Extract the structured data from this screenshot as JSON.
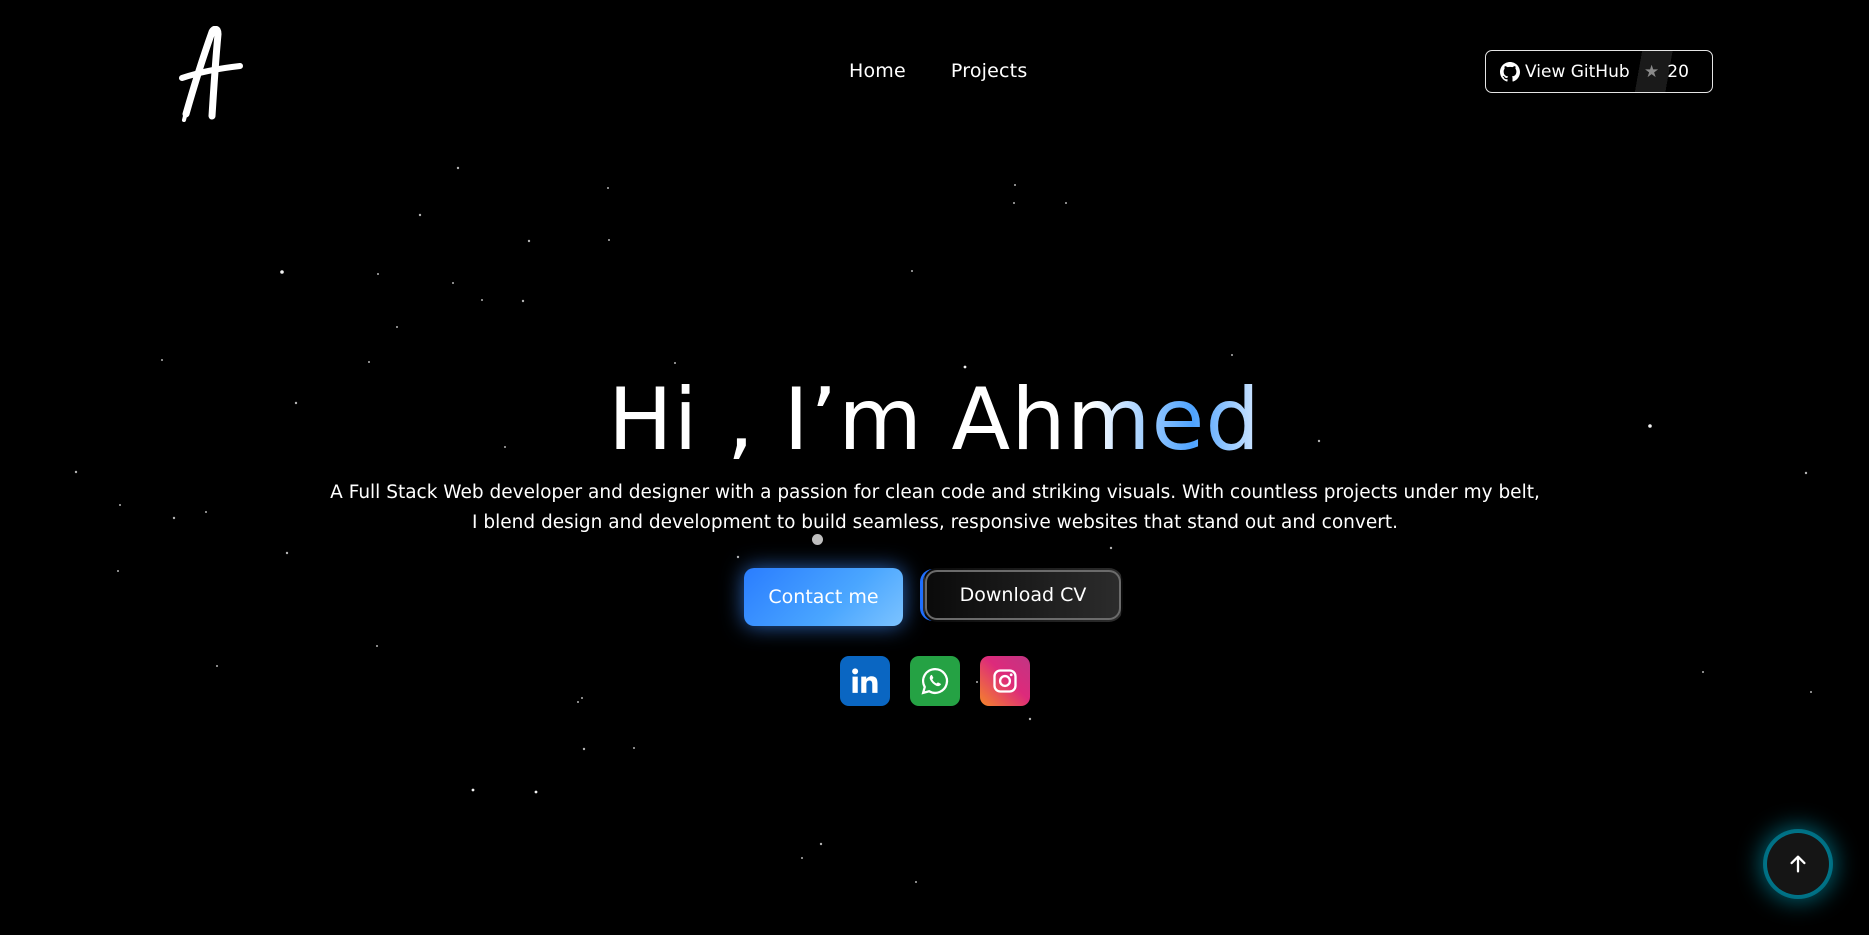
{
  "header": {
    "logo_text": "A",
    "nav": [
      {
        "label": "Home"
      },
      {
        "label": "Projects"
      }
    ],
    "github": {
      "label": "View GitHub",
      "stars": "20"
    }
  },
  "hero": {
    "greeting": "Hi , I’m ",
    "name": "Ahmed",
    "description": "A Full Stack Web developer and designer with a passion for clean code and striking visuals. With countless projects under my belt, I blend design and development to build seamless, responsive websites that stand out and convert.",
    "contact_label": "Contact me",
    "cv_label": "Download CV"
  },
  "socials": [
    {
      "name": "linkedin-icon",
      "color": "#0a66c2"
    },
    {
      "name": "whatsapp-icon",
      "color": "#25a244"
    },
    {
      "name": "instagram-icon",
      "color": "#dd2a7b"
    }
  ],
  "colors": {
    "background": "#000000",
    "accent": "#2a7dff",
    "scroll_glow": "#00b4d2"
  }
}
